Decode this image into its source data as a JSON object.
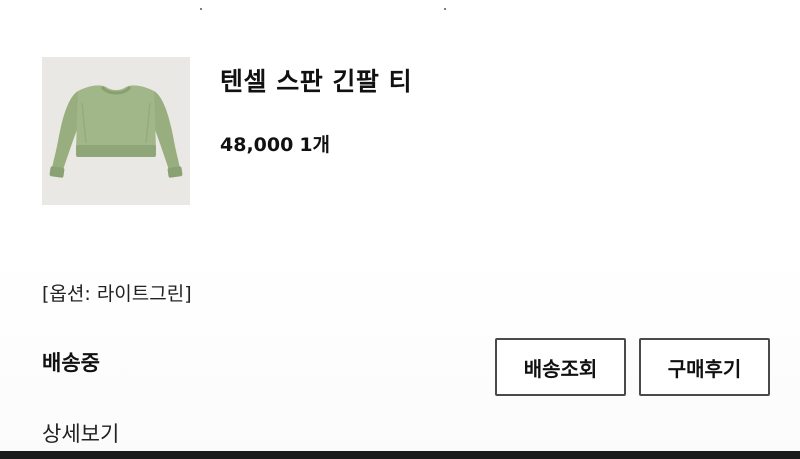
{
  "order": {
    "product_name": "텐셀 스판 긴팔 티",
    "price": "48,000",
    "quantity": "1개",
    "option": "[옵션: 라이트그린]",
    "status": "배송중",
    "thumbnail_icon": "light-green-cropped-sweater-image",
    "thumbnail_color": "#9eb484"
  },
  "actions": {
    "track_label": "배송조회",
    "review_label": "구매후기",
    "detail_label": "상세보기"
  },
  "colors": {
    "background": "#ffffff",
    "text": "#111111",
    "button_border": "#4a4a4a",
    "thumbnail_bg": "#e9e8e4"
  }
}
